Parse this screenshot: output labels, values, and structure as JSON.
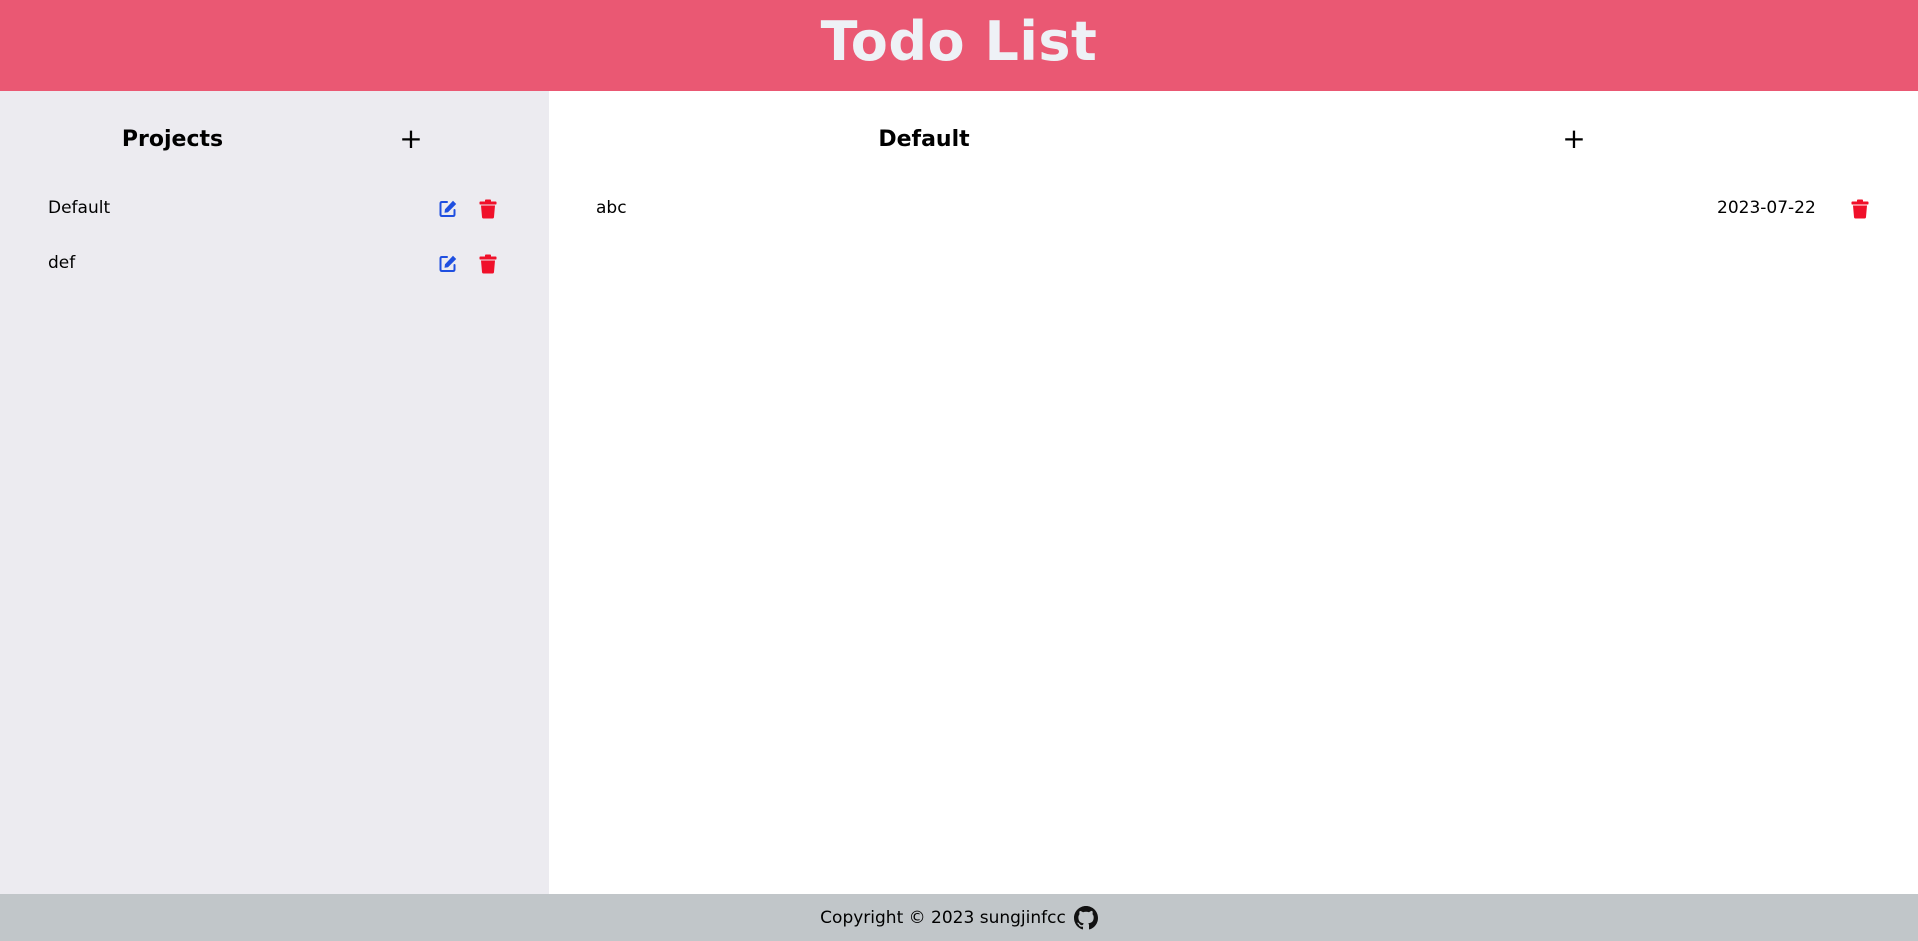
{
  "header": {
    "title": "Todo List"
  },
  "sidebar": {
    "title": "Projects",
    "add_label": "+",
    "projects": [
      {
        "name": "Default"
      },
      {
        "name": "def"
      }
    ]
  },
  "main": {
    "title": "Default",
    "add_label": "+",
    "todos": [
      {
        "title": "abc",
        "date": "2023-07-22"
      }
    ]
  },
  "footer": {
    "copyright": "Copyright © 2023 sungjinfcc",
    "icon": "github-icon"
  },
  "colors": {
    "header_bg": "#ea5873",
    "header_text": "#eef1f6",
    "sidebar_bg": "#ecebf0",
    "footer_bg": "#c1c6c9",
    "edit_icon": "#1f4fe0",
    "delete_icon": "#f0102a"
  }
}
